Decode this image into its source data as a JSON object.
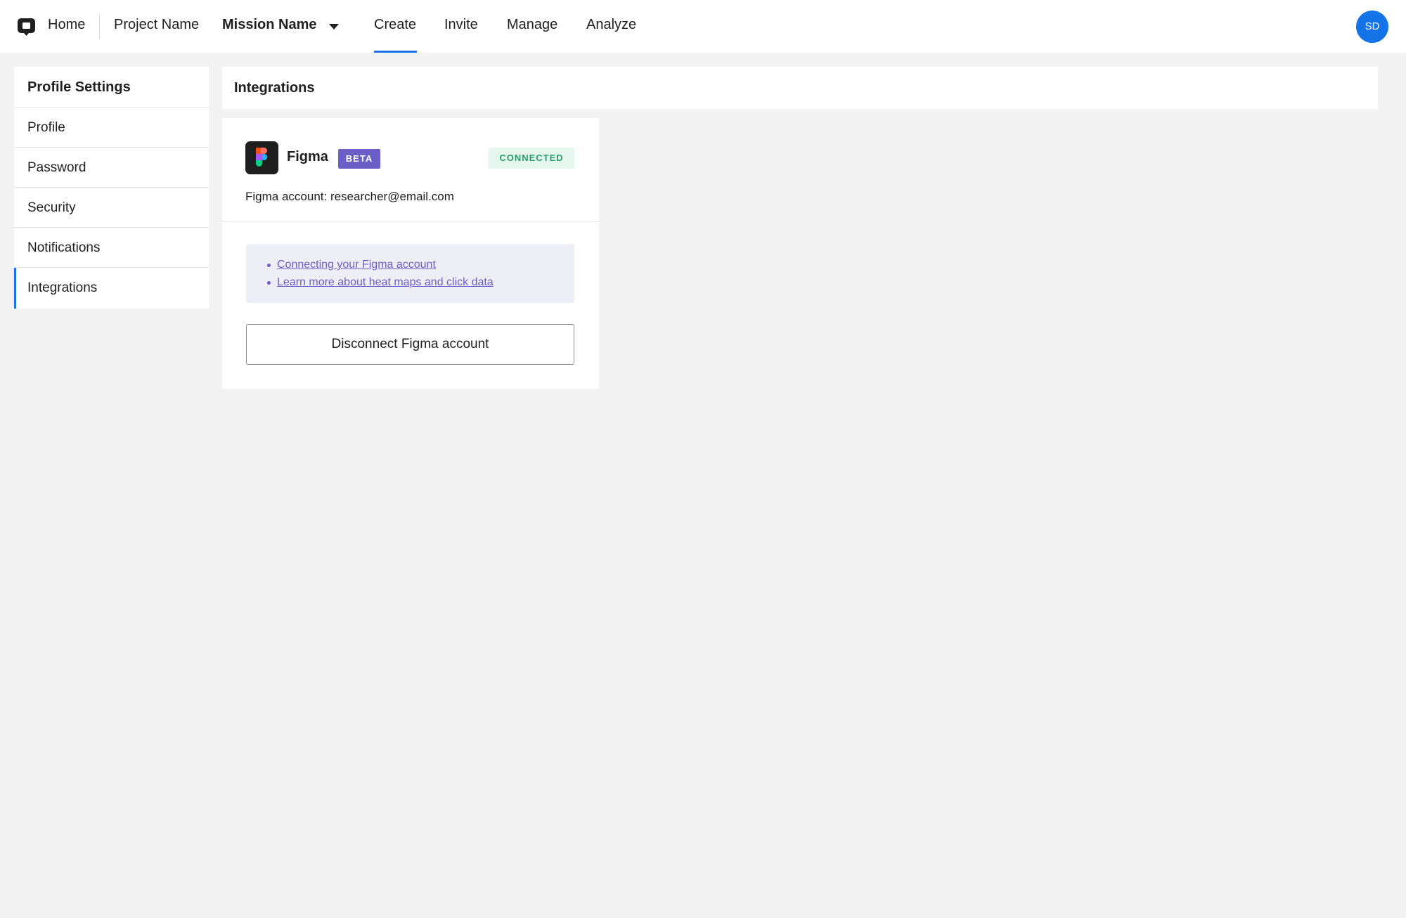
{
  "nav": {
    "home": "Home",
    "project": "Project Name",
    "mission": "Mission Name",
    "tabs": [
      "Create",
      "Invite",
      "Manage",
      "Analyze"
    ],
    "active_tab": "Create",
    "avatar_initials": "SD",
    "accent_color": "#1a73e8"
  },
  "sidebar": {
    "title": "Profile Settings",
    "items": [
      {
        "label": "Profile"
      },
      {
        "label": "Password"
      },
      {
        "label": "Security"
      },
      {
        "label": "Notifications"
      },
      {
        "label": "Integrations"
      }
    ],
    "active_item": "Integrations"
  },
  "main": {
    "title": "Integrations",
    "integration": {
      "name": "Figma",
      "icon": "figma-logo-icon",
      "beta_label": "BETA",
      "status": "CONNECTED",
      "account_line": "Figma account: researcher@email.com",
      "links": [
        "Connecting your Figma account",
        "Learn more about heat maps and click data"
      ],
      "disconnect_label": "Disconnect Figma account"
    }
  }
}
